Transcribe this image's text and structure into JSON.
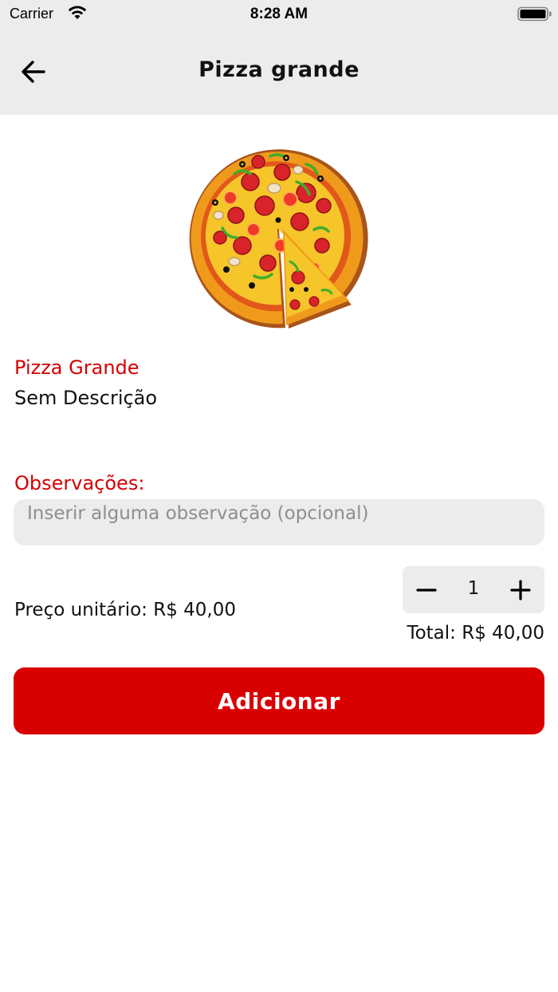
{
  "status_bar": {
    "carrier": "Carrier",
    "time": "8:28 AM",
    "wifi_icon": "wifi-icon",
    "battery_icon": "battery-full-icon"
  },
  "header": {
    "title": "Pizza grande",
    "back_icon": "arrow-left-icon"
  },
  "product": {
    "image_icon": "pizza-image",
    "name": "Pizza Grande",
    "description": "Sem Descrição"
  },
  "observations": {
    "label": "Observações:",
    "value": "",
    "placeholder": "Inserir alguma observação (opcional)"
  },
  "pricing": {
    "unit_price_text": "Preço unitário: R$ 40,00",
    "quantity": "1",
    "total_text": "Total: R$ 40,00"
  },
  "actions": {
    "add_label": "Adicionar"
  },
  "colors": {
    "accent": "#d90000",
    "label_red": "#d40000",
    "surface_gray": "#ececec"
  }
}
